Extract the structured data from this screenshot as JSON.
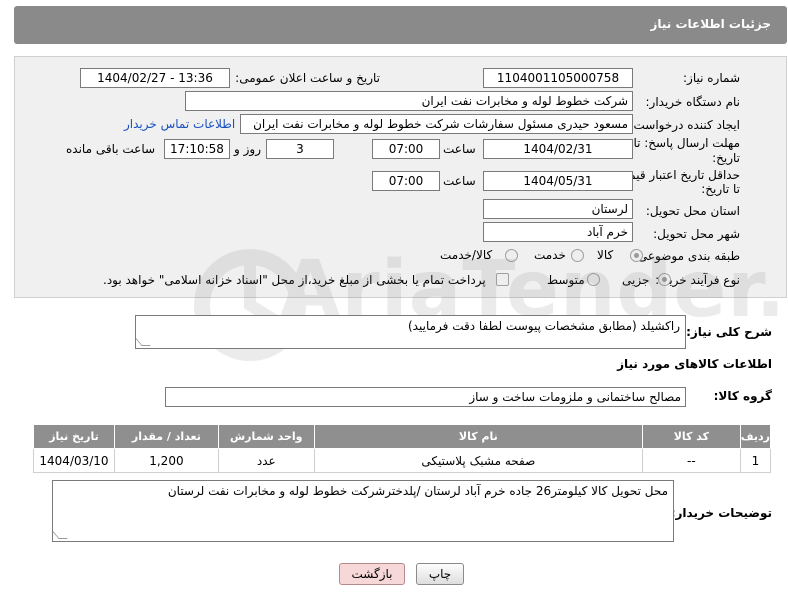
{
  "header": {
    "title": "جزئیات اطلاعات نیاز"
  },
  "form": {
    "need_number_label": "شماره نیاز:",
    "need_number": "1104001105000758",
    "announce_label": "تاریخ و ساعت اعلان عمومی:",
    "announce_value": "1404/02/27 - 13:36",
    "buyer_org_label": "نام دستگاه خریدار:",
    "buyer_org": "شرکت خطوط لوله و مخابرات نفت ایران",
    "creator_label": "ایجاد کننده درخواست:",
    "creator": "مسعود حیدری مسئول سفارشات شرکت خطوط لوله و مخابرات نفت ایران",
    "contact_link": "اطلاعات تماس خریدار",
    "deadline_label_1": "مهلت ارسال پاسخ: تا",
    "deadline_label_2": "تاریخ:",
    "deadline_date": "1404/02/31",
    "time_label": "ساعت",
    "deadline_time": "07:00",
    "days_value": "3",
    "days_label": "روز و",
    "remaining_time": "17:10:58",
    "remaining_label": "ساعت باقی مانده",
    "price_validity_label_1": "حداقل تاریخ اعتبار قیمت:",
    "price_validity_label_2": "تا تاریخ:",
    "price_validity_date": "1404/05/31",
    "price_validity_time": "07:00",
    "province_label": "استان محل تحویل:",
    "province": "لرستان",
    "city_label": "شهر محل تحویل:",
    "city": "خرم آباد",
    "category_label": "طبقه بندی موضوعی:",
    "category_options": [
      "کالا",
      "خدمت",
      "کالا/خدمت"
    ],
    "category_selected": "کالا",
    "process_label": "نوع فرآیند خرید :",
    "process_options": [
      "جزیی",
      "متوسط"
    ],
    "process_selected": "جزیی",
    "payment_note": "پرداخت تمام یا بخشی از مبلغ خرید،از محل \"اسناد خزانه اسلامی\" خواهد بود."
  },
  "description": {
    "label": "شرح کلی نیاز:",
    "value": "راکشیلد (مطابق مشخصات پیوست لطفا دقت فرمایید)"
  },
  "goods": {
    "section_title": "اطلاعات کالاهای مورد نیاز",
    "group_label": "گروه کالا:",
    "group_value": "مصالح ساختمانی و ملزومات ساخت و ساز",
    "columns": [
      "ردیف",
      "کد کالا",
      "نام کالا",
      "واحد شمارش",
      "تعداد / مقدار",
      "تاریخ نیاز"
    ],
    "rows": [
      {
        "index": "1",
        "code": "--",
        "name": "صفحه مشبک پلاستیکی",
        "unit": "عدد",
        "qty": "1,200",
        "date": "1404/03/10"
      }
    ]
  },
  "buyer_notes": {
    "label": "توضیحات خریدار:",
    "value": "محل تحویل کالا کیلومتر26 جاده خرم آباد لرستان /پلدخترشرکت خطوط لوله و مخابرات نفت لرستان"
  },
  "buttons": {
    "print": "چاپ",
    "back": "بازگشت"
  },
  "watermark": "AriaTender.neT",
  "colors": {
    "header_bg": "#8a8a8a",
    "panel_bg": "#f0f0f0",
    "link": "#1a4fc0",
    "back_button": "#f7d8d8"
  }
}
